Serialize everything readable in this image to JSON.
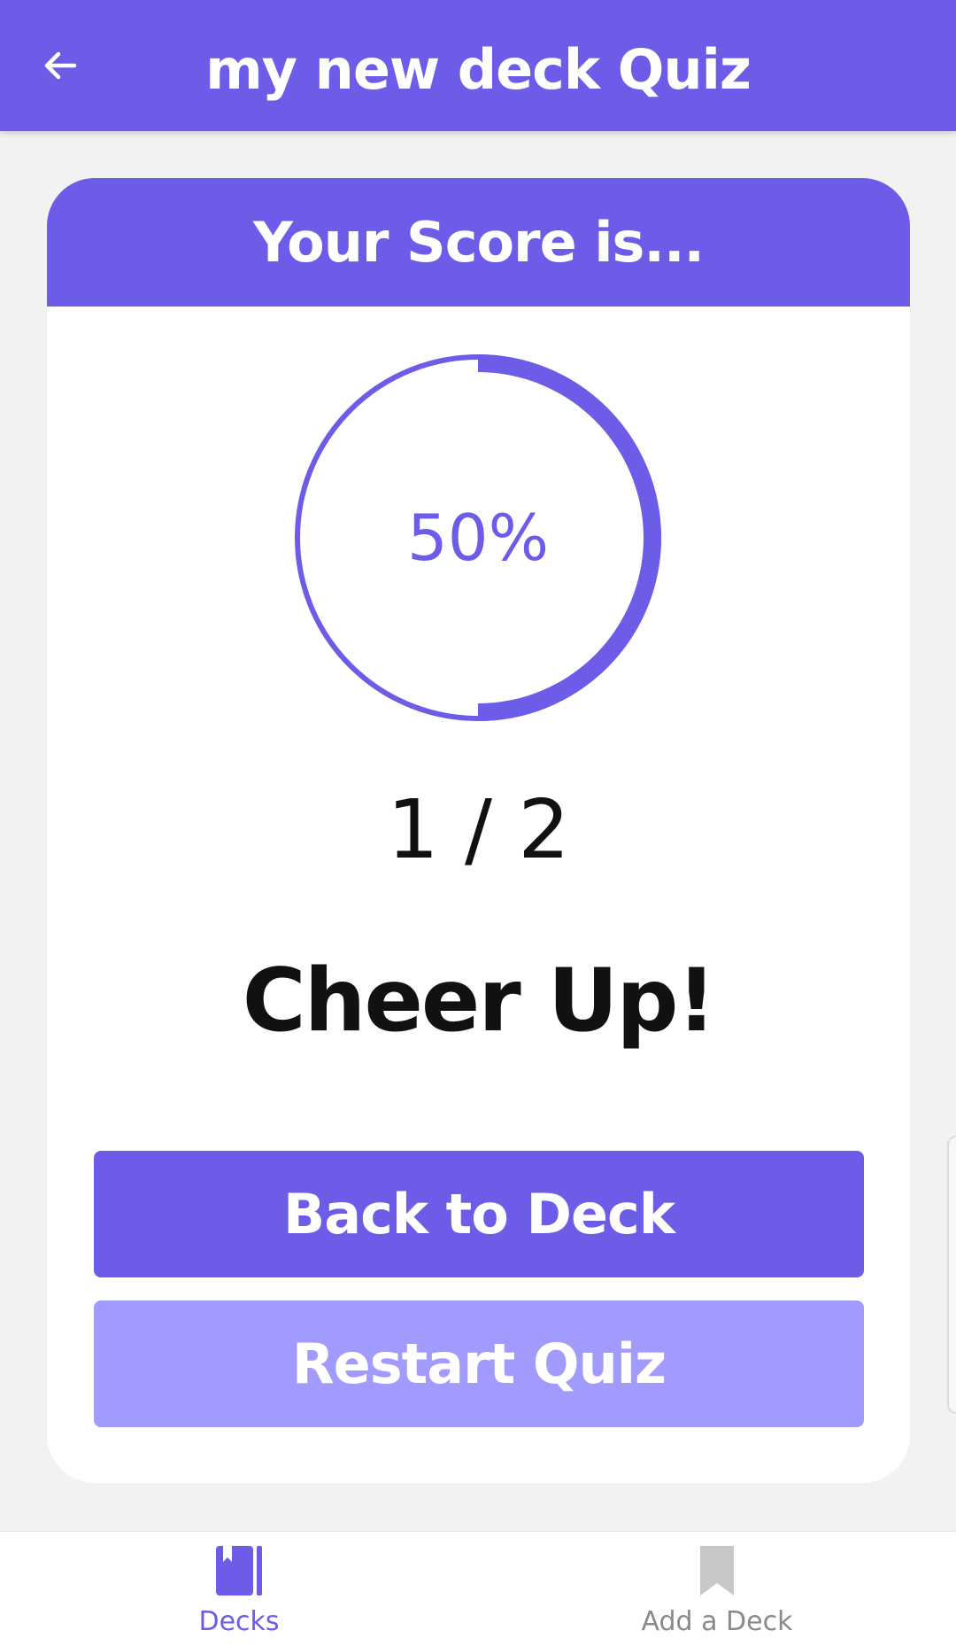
{
  "header": {
    "title": "my new deck Quiz",
    "back_icon": "arrow-left-icon"
  },
  "card": {
    "title": "Your Score is...",
    "gauge": {
      "percent_label": "50%",
      "fraction": 0.5
    },
    "score_fraction": "1 / 2",
    "message": "Cheer Up!"
  },
  "buttons": {
    "back_to_deck": "Back to Deck",
    "restart_quiz": "Restart Quiz"
  },
  "tabs": [
    {
      "label": "Decks",
      "icon": "book-icon",
      "active": true
    },
    {
      "label": "Add a Deck",
      "icon": "bookmark-icon",
      "active": false
    }
  ],
  "colors": {
    "primary": "#6c5ce7",
    "primary_light": "#a29bfe",
    "inactive": "#c8c8c8"
  }
}
